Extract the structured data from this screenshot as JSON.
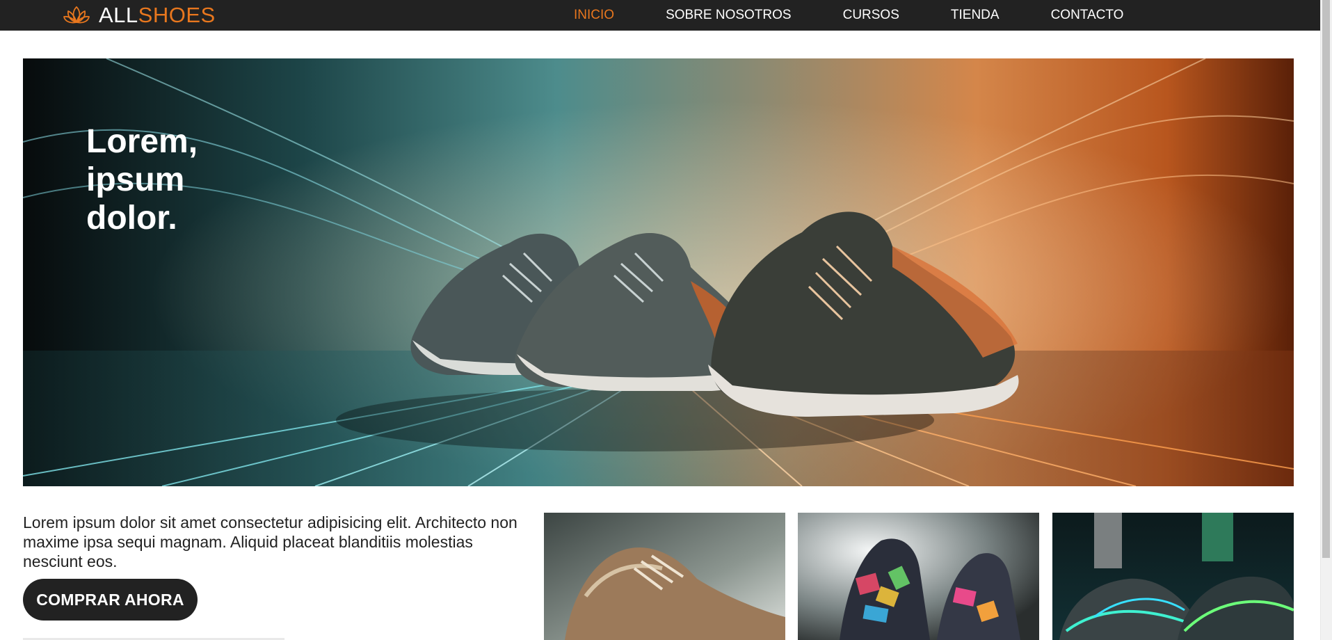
{
  "header": {
    "logo": {
      "brand_part1": "ALL",
      "brand_part2": "SHOES",
      "icon": "lotus-icon"
    },
    "nav": [
      {
        "label": "INICIO",
        "active": true
      },
      {
        "label": "SOBRE NOSOTROS",
        "active": false
      },
      {
        "label": "CURSOS",
        "active": false
      },
      {
        "label": "TIENDA",
        "active": false
      },
      {
        "label": "CONTACTO",
        "active": false
      }
    ]
  },
  "hero": {
    "title": "Lorem, ipsum dolor."
  },
  "content": {
    "intro": "Lorem ipsum dolor sit amet consectetur adipisicing elit. Architecto non maxime ipsa sequi magnam. Aliquid placeat blanditiis molestias nesciunt eos.",
    "cta_label": "COMPRAR AHORA"
  },
  "colors": {
    "accent": "#e8771e",
    "header_bg": "#222222",
    "button_bg": "#222222"
  }
}
